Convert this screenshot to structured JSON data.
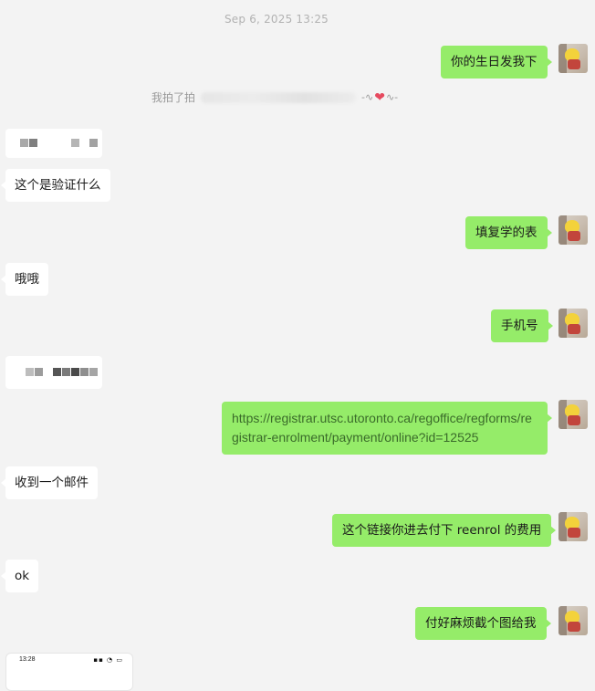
{
  "timestamp": "Sep 6, 2025 13:25",
  "pat_text": "我拍了拍",
  "messages": {
    "m1": "你的生日发我下",
    "m2": "这个是验证什么",
    "m3": "填复学的表",
    "m4": "哦哦",
    "m5": "手机号",
    "m6": "https://registrar.utsc.utoronto.ca/regoffice/regforms/registrar-enrolment/payment/online?id=12525",
    "m7": "收到一个邮件",
    "m8": "这个链接你进去付下 reenrol 的费用",
    "m9": "ok",
    "m10": "付好麻烦截个图给我"
  },
  "phone_thumbnail": {
    "time": "13:28",
    "status_icons": "▪▪ ◔ ▭"
  },
  "colors": {
    "background": "#f3f3f3",
    "my_bubble": "#95ec69",
    "other_bubble": "#ffffff",
    "heart": "#e64a5f"
  }
}
